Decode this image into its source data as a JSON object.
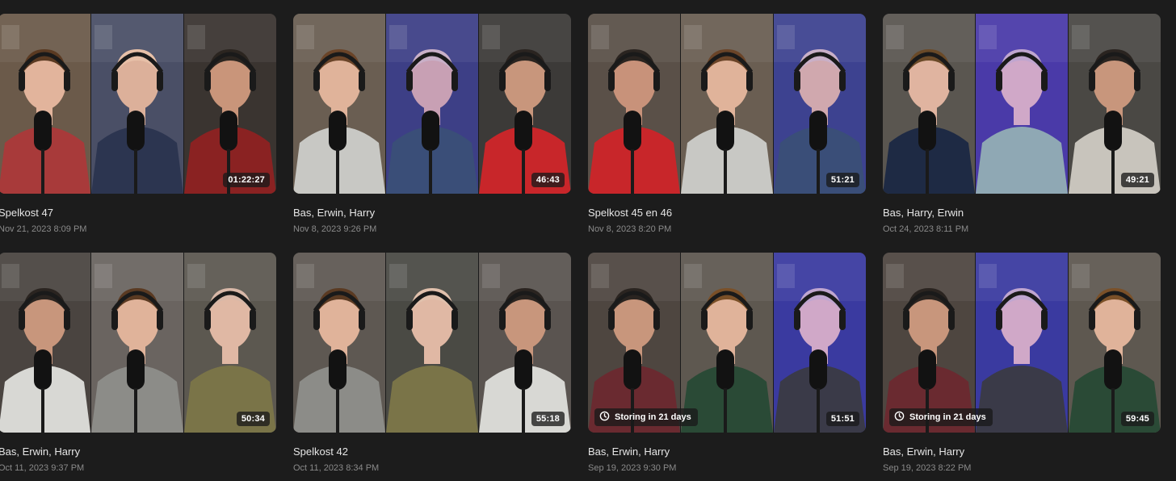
{
  "recordings": [
    {
      "title": "Spelkost 47",
      "date": "Nov 21, 2023 8:09 PM",
      "duration": "01:22:27",
      "storing": "",
      "tiles": [
        {
          "bg": "#6b5a4a",
          "hair": "#5a3a22",
          "skin": "#e2b49c",
          "shirt": "#a83a3a",
          "mic": true
        },
        {
          "bg": "#4a4f66",
          "hair": "#e7c0a8",
          "skin": "#dcb09a",
          "shirt": "#2c3550",
          "mic": true
        },
        {
          "bg": "#3a3430",
          "hair": "#2b2520",
          "skin": "#c9957a",
          "shirt": "#8a2222",
          "mic": true
        }
      ]
    },
    {
      "title": "Bas, Erwin, Harry",
      "date": "Nov 8, 2023 9:26 PM",
      "duration": "46:43",
      "storing": "",
      "tiles": [
        {
          "bg": "#6a5e52",
          "hair": "#6a4428",
          "skin": "#e0b39a",
          "shirt": "#c8c8c4",
          "mic": true
        },
        {
          "bg": "#3d3f86",
          "hair": "#c9b0c8",
          "skin": "#c8a0b4",
          "shirt": "#3a4e78",
          "mic": true
        },
        {
          "bg": "#3c3a38",
          "hair": "#2a2420",
          "skin": "#c8967c",
          "shirt": "#c8262a",
          "mic": true
        }
      ]
    },
    {
      "title": "Spelkost 45 en 46",
      "date": "Nov 8, 2023 8:20 PM",
      "duration": "51:21",
      "storing": "",
      "tiles": [
        {
          "bg": "#5a5048",
          "hair": "#2a2420",
          "skin": "#c8927a",
          "shirt": "#c8262a",
          "mic": true
        },
        {
          "bg": "#6a5e52",
          "hair": "#6a4428",
          "skin": "#e0b39a",
          "shirt": "#c8c8c4",
          "mic": true
        },
        {
          "bg": "#3d4290",
          "hair": "#c9b0c8",
          "skin": "#d0a8ae",
          "shirt": "#3a4e78",
          "mic": true
        }
      ]
    },
    {
      "title": "Bas, Harry, Erwin",
      "date": "Oct 24, 2023 8:11 PM",
      "duration": "49:21",
      "storing": "",
      "tiles": [
        {
          "bg": "#5a5650",
          "hair": "#6a4a28",
          "skin": "#e0b4a0",
          "shirt": "#1e2a44",
          "mic": true
        },
        {
          "bg": "#4a3aa8",
          "hair": "#c0a6d0",
          "skin": "#d0a8c8",
          "shirt": "#8fa8b4",
          "mic": false
        },
        {
          "bg": "#4a4844",
          "hair": "#2a2420",
          "skin": "#c8967c",
          "shirt": "#c8c4bc",
          "mic": true
        }
      ]
    },
    {
      "title": "Bas, Erwin, Harry",
      "date": "Oct 11, 2023 9:37 PM",
      "duration": "50:34",
      "storing": "",
      "tiles": [
        {
          "bg": "#4a4440",
          "hair": "#2a2420",
          "skin": "#c8967c",
          "shirt": "#d8d8d4",
          "mic": true
        },
        {
          "bg": "#6a6460",
          "hair": "#5a3a22",
          "skin": "#e0b39a",
          "shirt": "#8c8c88",
          "mic": true
        },
        {
          "bg": "#5c5850",
          "hair": "#d8b8a8",
          "skin": "#e0b8a4",
          "shirt": "#7a7448",
          "mic": false
        }
      ]
    },
    {
      "title": "Spelkost 42",
      "date": "Oct 11, 2023 8:34 PM",
      "duration": "55:18",
      "storing": "",
      "tiles": [
        {
          "bg": "#5e5852",
          "hair": "#5a3a22",
          "skin": "#e0b39a",
          "shirt": "#8c8c88",
          "mic": true
        },
        {
          "bg": "#4a4a44",
          "hair": "#e0c0ac",
          "skin": "#e0b8a4",
          "shirt": "#7a7448",
          "mic": false
        },
        {
          "bg": "#5a5450",
          "hair": "#2a2420",
          "skin": "#c8967c",
          "shirt": "#d8d8d4",
          "mic": true
        }
      ]
    },
    {
      "title": "Bas, Erwin, Harry",
      "date": "Sep 19, 2023 9:30 PM",
      "duration": "51:51",
      "storing": "Storing in 21 days",
      "tiles": [
        {
          "bg": "#4e4640",
          "hair": "#2a2420",
          "skin": "#c8967c",
          "shirt": "#6a2a30",
          "mic": true
        },
        {
          "bg": "#5e5850",
          "hair": "#7a5028",
          "skin": "#e0b39a",
          "shirt": "#2a4a36",
          "mic": true
        },
        {
          "bg": "#3a3aa0",
          "hair": "#c0a6d0",
          "skin": "#d0a8c8",
          "shirt": "#3a3a48",
          "mic": true
        }
      ]
    },
    {
      "title": "Bas, Erwin, Harry",
      "date": "Sep 19, 2023 8:22 PM",
      "duration": "59:45",
      "storing": "Storing in 21 days",
      "tiles": [
        {
          "bg": "#4e4640",
          "hair": "#2a2420",
          "skin": "#c8967c",
          "shirt": "#6a2a30",
          "mic": true
        },
        {
          "bg": "#3a3aa0",
          "hair": "#c0a6d0",
          "skin": "#d0a8c8",
          "shirt": "#3a3a48",
          "mic": false
        },
        {
          "bg": "#5e5850",
          "hair": "#7a5028",
          "skin": "#e0b39a",
          "shirt": "#2a4a36",
          "mic": true
        }
      ]
    }
  ]
}
